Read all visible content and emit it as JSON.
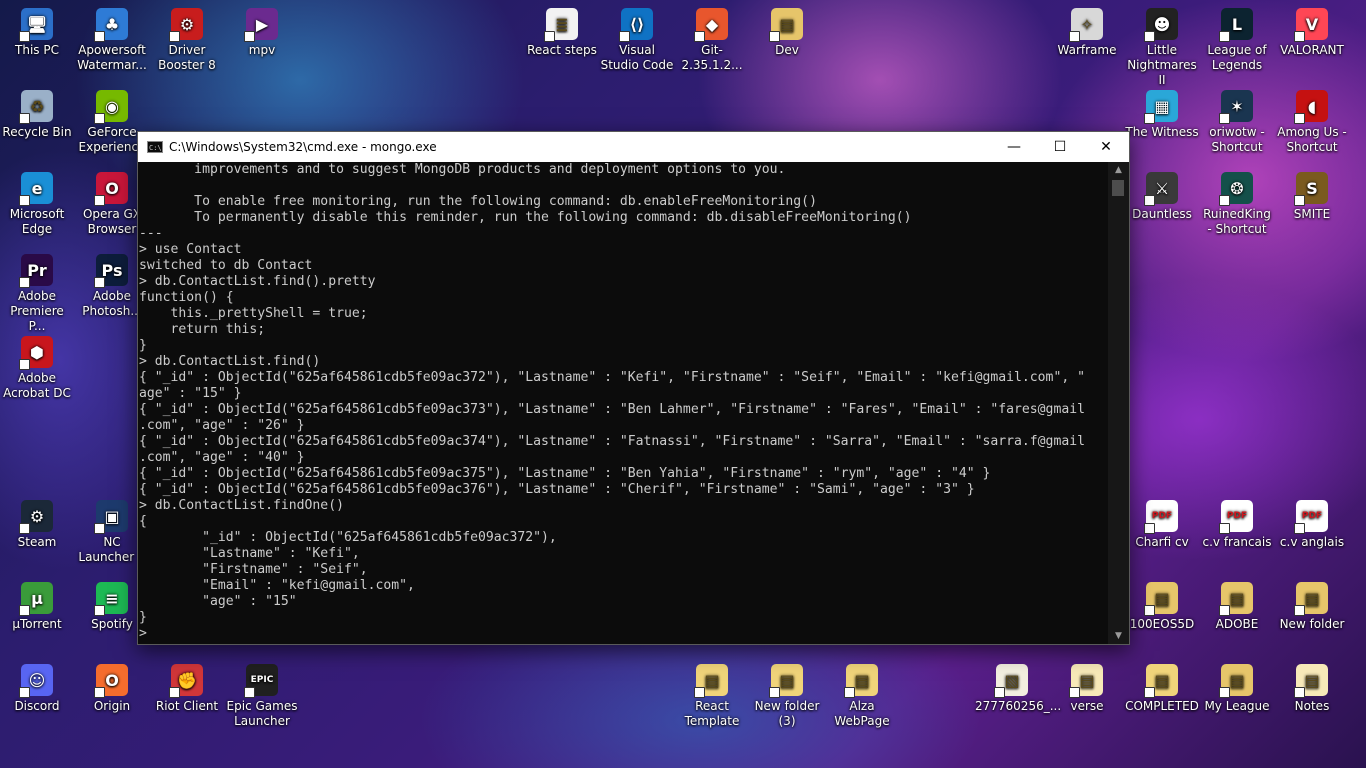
{
  "desktop": {
    "icons": [
      {
        "label": "This PC",
        "glyph": "🖥",
        "color": "#2b6fc9"
      },
      {
        "label": "Apowersoft Watermar...",
        "glyph": "♣",
        "color": "#2e7bd6"
      },
      {
        "label": "Driver Booster 8",
        "glyph": "⚙",
        "color": "#c81d1d"
      },
      {
        "label": "mpv",
        "glyph": "▶",
        "color": "#6b2a8f"
      },
      {
        "label": "Recycle Bin",
        "glyph": "♻",
        "color": "#9ab0c8"
      },
      {
        "label": "GeForce Experience",
        "glyph": "◉",
        "color": "#76b900"
      },
      {
        "label": "Microsoft Edge",
        "glyph": "e",
        "color": "#1a8fd6"
      },
      {
        "label": "Opera GX Browser",
        "glyph": "O",
        "color": "#c9163a"
      },
      {
        "label": "Adobe Premiere P...",
        "glyph": "Pr",
        "color": "#2a0a47"
      },
      {
        "label": "Adobe Photosh...",
        "glyph": "Ps",
        "color": "#0d1d3b"
      },
      {
        "label": "Adobe Acrobat DC",
        "glyph": "⬢",
        "color": "#c8161d"
      },
      {
        "label": "Steam",
        "glyph": "⚙",
        "color": "#1b2838"
      },
      {
        "label": "NC Launcher 2",
        "glyph": "▣",
        "color": "#1d3a6d"
      },
      {
        "label": "µTorrent",
        "glyph": "µ",
        "color": "#3a9b3a"
      },
      {
        "label": "Spotify",
        "glyph": "≡",
        "color": "#1db954"
      },
      {
        "label": "Discord",
        "glyph": "☺",
        "color": "#5865f2"
      },
      {
        "label": "Origin",
        "glyph": "O",
        "color": "#f56c2d"
      },
      {
        "label": "Riot Client",
        "glyph": "✊",
        "color": "#d13639"
      },
      {
        "label": "Epic Games Launcher",
        "glyph": "EPIC",
        "color": "#202020"
      },
      {
        "label": "React steps",
        "glyph": "≣",
        "color": "#f2f2f2"
      },
      {
        "label": "Visual Studio Code",
        "glyph": "⟨⟩",
        "color": "#0f72c4"
      },
      {
        "label": "Git-2.35.1.2...",
        "glyph": "◆",
        "color": "#e8562d"
      },
      {
        "label": "Dev",
        "glyph": "▤",
        "color": "#e6c56a"
      },
      {
        "label": "Warframe",
        "glyph": "✧",
        "color": "#d8d8d8"
      },
      {
        "label": "Little Nightmares II",
        "glyph": "☻",
        "color": "#222"
      },
      {
        "label": "League of Legends",
        "glyph": "L",
        "color": "#0c2330"
      },
      {
        "label": "VALORANT",
        "glyph": "V",
        "color": "#ff4655"
      },
      {
        "label": "The Witness",
        "glyph": "▦",
        "color": "#2aa7d8"
      },
      {
        "label": "oriwotw - Shortcut",
        "glyph": "✶",
        "color": "#1a3550"
      },
      {
        "label": "Among Us - Shortcut",
        "glyph": "◖",
        "color": "#c51111"
      },
      {
        "label": "Dauntless",
        "glyph": "⚔",
        "color": "#3a3a3a"
      },
      {
        "label": "RuinedKing - Shortcut",
        "glyph": "❂",
        "color": "#14504a"
      },
      {
        "label": "SMITE",
        "glyph": "S",
        "color": "#7a5a1f"
      },
      {
        "label": "Charfi cv",
        "glyph": "PDF",
        "color": "#ffffff"
      },
      {
        "label": "c.v francais",
        "glyph": "PDF",
        "color": "#ffffff"
      },
      {
        "label": "c.v anglais",
        "glyph": "PDF",
        "color": "#ffffff"
      },
      {
        "label": "100EOS5D",
        "glyph": "▤",
        "color": "#e6c56a"
      },
      {
        "label": "ADOBE",
        "glyph": "▤",
        "color": "#e6c56a"
      },
      {
        "label": "New folder",
        "glyph": "▤",
        "color": "#e6c56a"
      },
      {
        "label": "React Template",
        "glyph": "▤",
        "color": "#f0d47a"
      },
      {
        "label": "New folder (3)",
        "glyph": "▤",
        "color": "#f0d47a"
      },
      {
        "label": "Alza WebPage",
        "glyph": "▤",
        "color": "#f0d47a"
      },
      {
        "label": "277760256_...",
        "glyph": "▧",
        "color": "#f3efe0"
      },
      {
        "label": "verse",
        "glyph": "▤",
        "color": "#f7e9b8"
      },
      {
        "label": "COMPLETED",
        "glyph": "▤",
        "color": "#f0d47a"
      },
      {
        "label": "My League",
        "glyph": "▤",
        "color": "#e6c56a"
      },
      {
        "label": "Notes",
        "glyph": "▤",
        "color": "#f7e9b8"
      }
    ]
  },
  "window": {
    "title": "C:\\Windows\\System32\\cmd.exe - mongo.exe",
    "icon_text": "C:\\",
    "controls": {
      "minimize": "—",
      "maximize": "☐",
      "close": "✕"
    }
  },
  "console": {
    "lines": [
      "       improvements and to suggest MongoDB products and deployment options to you.",
      "",
      "       To enable free monitoring, run the following command: db.enableFreeMonitoring()",
      "       To permanently disable this reminder, run the following command: db.disableFreeMonitoring()",
      "---",
      "> use Contact",
      "switched to db Contact",
      "> db.ContactList.find().pretty",
      "function() {",
      "    this._prettyShell = true;",
      "    return this;",
      "}",
      "> db.ContactList.find()",
      "{ \"_id\" : ObjectId(\"625af645861cdb5fe09ac372\"), \"Lastname\" : \"Kefi\", \"Firstname\" : \"Seif\", \"Email\" : \"kefi@gmail.com\", \"",
      "age\" : \"15\" }",
      "{ \"_id\" : ObjectId(\"625af645861cdb5fe09ac373\"), \"Lastname\" : \"Ben Lahmer\", \"Firstname\" : \"Fares\", \"Email\" : \"fares@gmail",
      ".com\", \"age\" : \"26\" }",
      "{ \"_id\" : ObjectId(\"625af645861cdb5fe09ac374\"), \"Lastname\" : \"Fatnassi\", \"Firstname\" : \"Sarra\", \"Email\" : \"sarra.f@gmail",
      ".com\", \"age\" : \"40\" }",
      "{ \"_id\" : ObjectId(\"625af645861cdb5fe09ac375\"), \"Lastname\" : \"Ben Yahia\", \"Firstname\" : \"rym\", \"age\" : \"4\" }",
      "{ \"_id\" : ObjectId(\"625af645861cdb5fe09ac376\"), \"Lastname\" : \"Cherif\", \"Firstname\" : \"Sami\", \"age\" : \"3\" }",
      "> db.ContactList.findOne()",
      "{",
      "        \"_id\" : ObjectId(\"625af645861cdb5fe09ac372\"),",
      "        \"Lastname\" : \"Kefi\",",
      "        \"Firstname\" : \"Seif\",",
      "        \"Email\" : \"kefi@gmail.com\",",
      "        \"age\" : \"15\"",
      "}",
      ">"
    ]
  }
}
